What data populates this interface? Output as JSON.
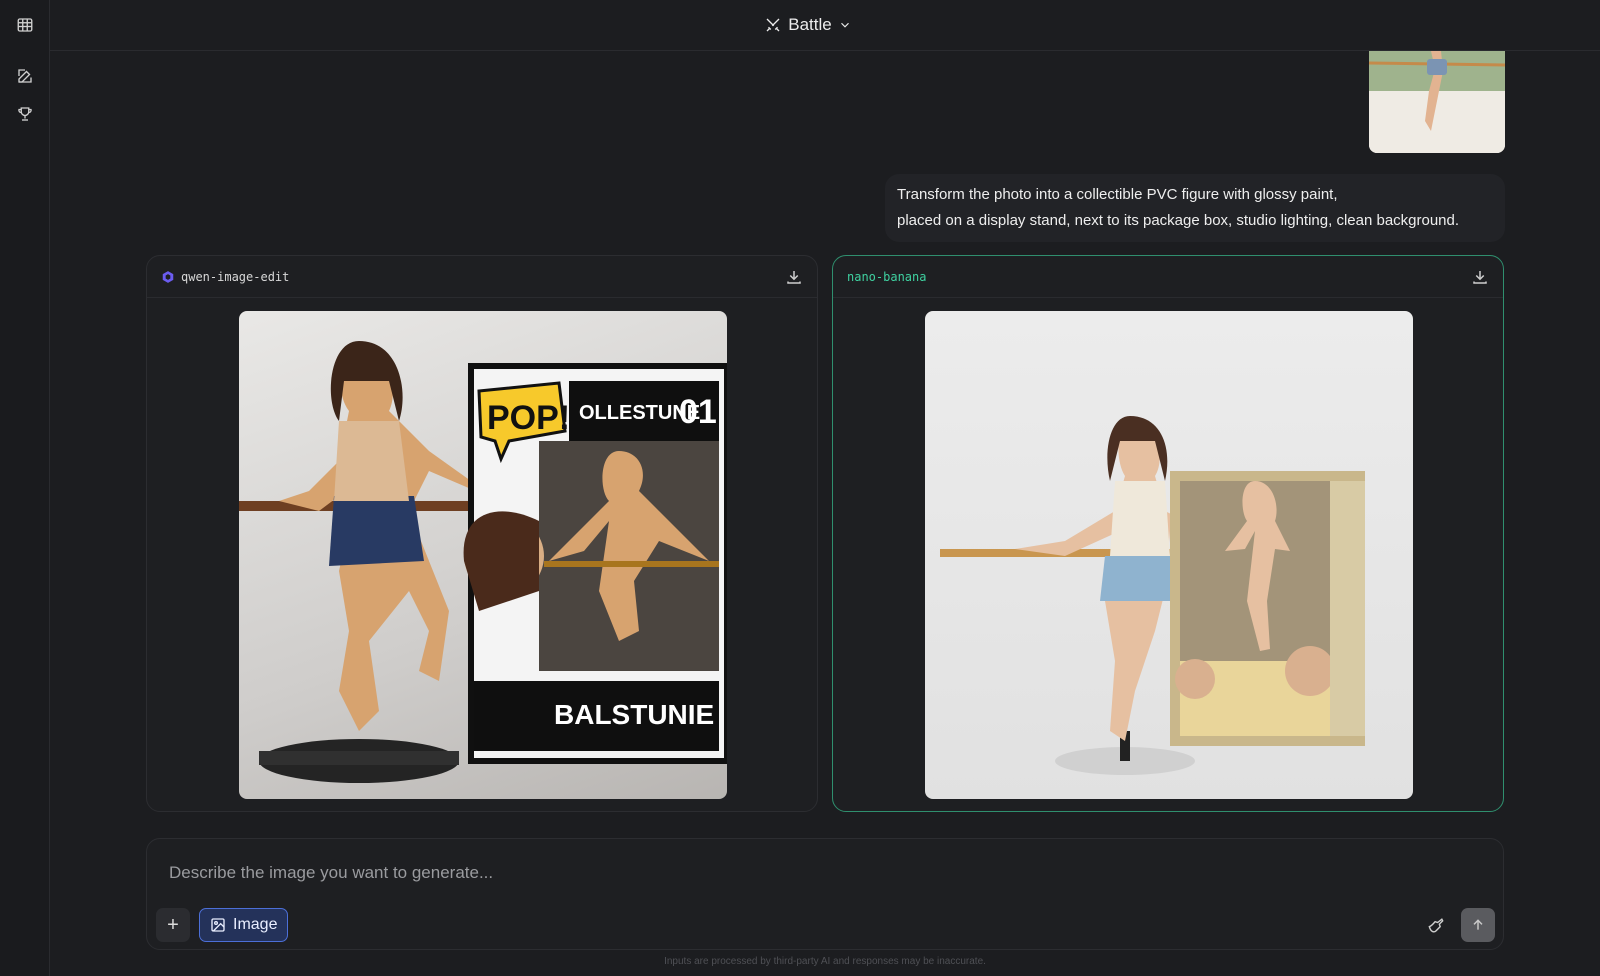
{
  "header": {
    "mode_label": "Battle"
  },
  "prompt": {
    "line1": "Transform the photo into a collectible PVC figure with glossy paint,",
    "line2": "placed on a display stand, next to its package box, studio lighting, clean background."
  },
  "results": [
    {
      "model": "qwen-image-edit"
    },
    {
      "model": "nano-banana"
    }
  ],
  "composer": {
    "placeholder": "Describe the image you want to generate...",
    "image_label": "Image"
  },
  "disclaimer": "Inputs are processed by third-party AI and responses may be inaccurate.",
  "colors": {
    "accent": "#3fd1a0",
    "image_button": "#4c6fd8"
  }
}
